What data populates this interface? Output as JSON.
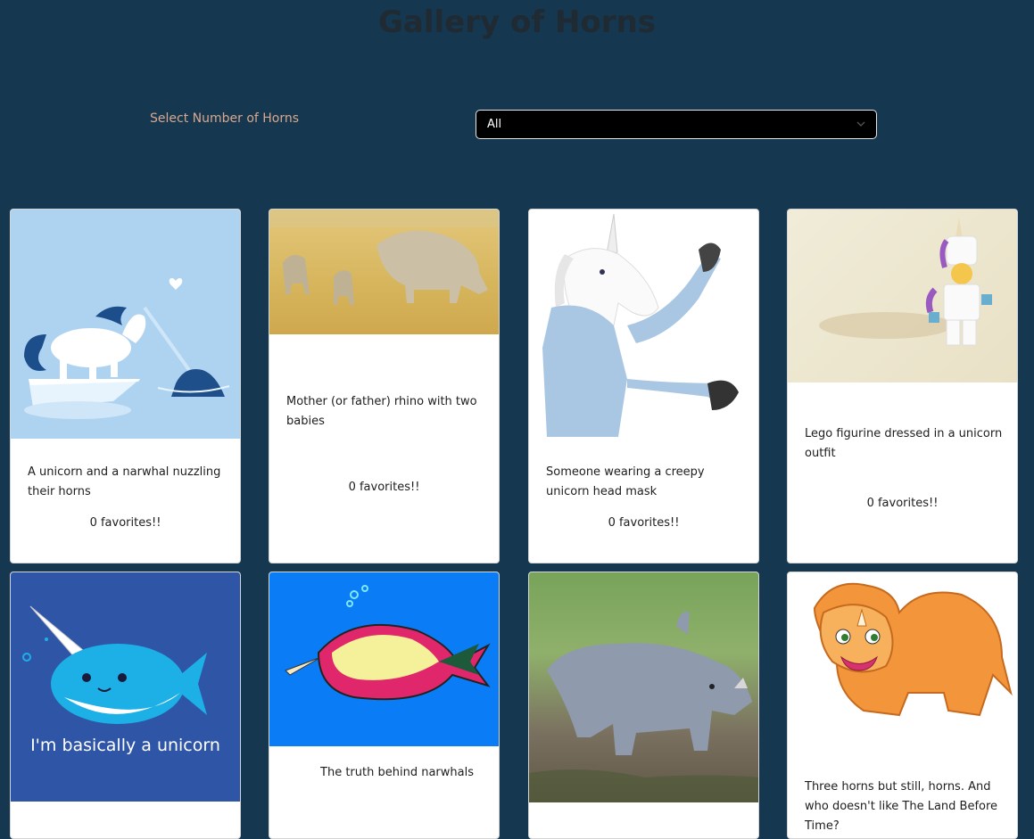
{
  "page": {
    "title": "Gallery of Horns"
  },
  "filter": {
    "label": "Select Number of Horns",
    "selected": "All"
  },
  "cards": [
    {
      "image": "unicorn-narwhal-illustration",
      "description": "A unicorn and a narwhal nuzzling their horns",
      "favorites": "0 favorites!!"
    },
    {
      "image": "rhino-family-photo",
      "description": "Mother (or father) rhino with two babies",
      "favorites": "0 favorites!!"
    },
    {
      "image": "unicorn-mask-photo",
      "description": "Someone wearing a creepy unicorn head mask",
      "favorites": "0 favorites!!"
    },
    {
      "image": "lego-unicorn-photo",
      "description": "Lego figurine dressed in a unicorn outfit",
      "favorites": "0 favorites!!"
    },
    {
      "image": "narwhal-cartoon",
      "caption": "I'm basically a unicorn"
    },
    {
      "image": "narwhal-xray-illustration",
      "description": "The truth behind narwhals"
    },
    {
      "image": "baby-rhino-photo"
    },
    {
      "image": "triceratops-cartoon",
      "description": "Three horns but still, horns. And who doesn't like The Land Before Time?"
    }
  ],
  "colors": {
    "background": "#15374f",
    "label": "#d9a88e",
    "title": "#1f2a33"
  }
}
